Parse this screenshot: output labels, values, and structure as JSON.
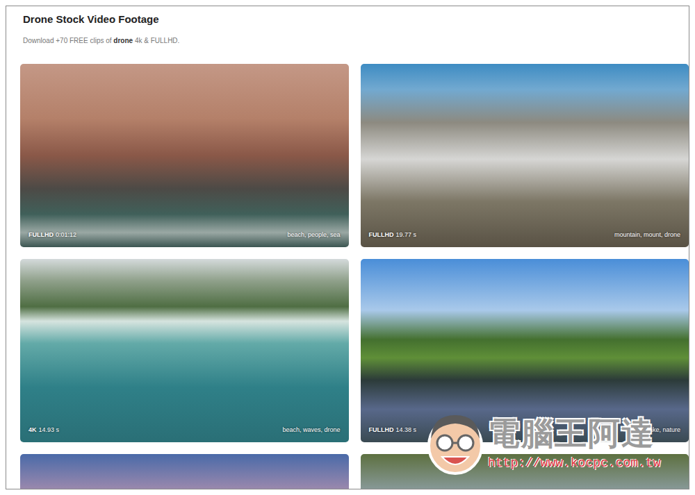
{
  "page": {
    "title": "Drone Stock Video Footage",
    "subtitle": {
      "before": "Download +70 FREE clips of ",
      "bold": "drone",
      "after": " 4k & FULLHD."
    }
  },
  "clips": [
    {
      "kind": "full",
      "quality": "FULLHD",
      "duration": "0:01:12",
      "tags": "beach, people, sea"
    },
    {
      "kind": "full",
      "quality": "FULLHD",
      "duration": "19.77 s",
      "tags": "mountain, mount, drone"
    },
    {
      "kind": "full",
      "quality": "4K",
      "duration": "14.93 s",
      "tags": "beach, waves, drone"
    },
    {
      "kind": "full",
      "quality": "FULLHD",
      "duration": "14.38 s",
      "tags": "drone, lake, nature"
    },
    {
      "kind": "cut"
    },
    {
      "kind": "cut"
    }
  ],
  "watermark": {
    "site_name": "電腦王阿達",
    "url": "http://www.kocpc.com.tw"
  }
}
